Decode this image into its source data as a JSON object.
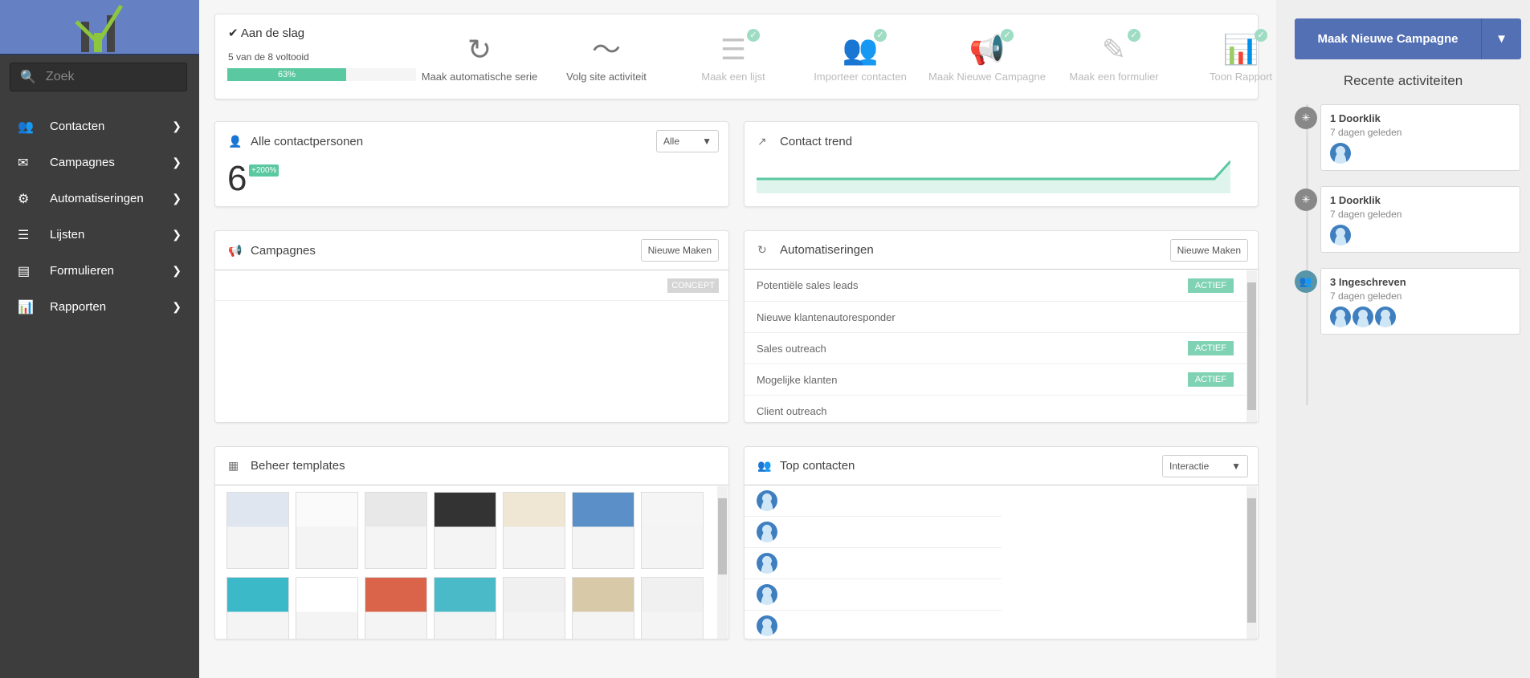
{
  "search": {
    "placeholder": "Zoek"
  },
  "nav": [
    {
      "label": "Contacten",
      "icon": "contacts-icon"
    },
    {
      "label": "Campagnes",
      "icon": "envelope-icon"
    },
    {
      "label": "Automatiseringen",
      "icon": "automation-icon"
    },
    {
      "label": "Lijsten",
      "icon": "list-icon"
    },
    {
      "label": "Formulieren",
      "icon": "form-icon"
    },
    {
      "label": "Rapporten",
      "icon": "chart-icon"
    }
  ],
  "getting_started": {
    "title": "Aan de slag",
    "progress_text": "5 van de 8 voltooid",
    "progress_percent": 63,
    "progress_label": "63%",
    "steps": [
      {
        "label": "Maak automatische serie",
        "done": false
      },
      {
        "label": "Volg site activiteit",
        "done": false
      },
      {
        "label": "Maak een lijst",
        "done": true
      },
      {
        "label": "Importeer contacten",
        "done": true
      },
      {
        "label": "Maak Nieuwe Campagne",
        "done": true
      },
      {
        "label": "Maak een formulier",
        "done": true
      },
      {
        "label": "Toon Rapport",
        "done": true
      }
    ]
  },
  "contacts": {
    "title": "Alle contactpersonen",
    "count": "6",
    "change": "+200%",
    "filter": "Alle"
  },
  "trend": {
    "title": "Contact trend"
  },
  "campaigns": {
    "title": "Campagnes",
    "new_label": "Nieuwe Maken",
    "items": [
      {
        "status": "CONCEPT"
      }
    ]
  },
  "automations": {
    "title": "Automatiseringen",
    "new_label": "Nieuwe Maken",
    "items": [
      {
        "name": "Potentiële sales leads",
        "status": "ACTIEF"
      },
      {
        "name": "Nieuwe klantenautoresponder",
        "status": ""
      },
      {
        "name": "Sales outreach",
        "status": "ACTIEF"
      },
      {
        "name": "Mogelijke klanten",
        "status": "ACTIEF"
      },
      {
        "name": "Client outreach",
        "status": ""
      }
    ]
  },
  "templates": {
    "title": "Beheer templates",
    "count": 14
  },
  "top_contacts": {
    "title": "Top contacten",
    "filter": "Interactie",
    "count": 5
  },
  "right": {
    "new_campaign": "Maak Nieuwe Campagne",
    "recent_title": "Recente activiteiten",
    "activities": [
      {
        "title": "1 Doorklik",
        "time": "7 dagen geleden",
        "avatars": 1,
        "type": "click"
      },
      {
        "title": "1 Doorklik",
        "time": "7 dagen geleden",
        "avatars": 1,
        "type": "click"
      },
      {
        "title": "3 Ingeschreven",
        "time": "7 dagen geleden",
        "avatars": 3,
        "type": "subscribe"
      }
    ]
  },
  "colors": {
    "accent": "#5ac8a0",
    "brand": "#5470b5",
    "sidebar": "#3d3d3d"
  }
}
